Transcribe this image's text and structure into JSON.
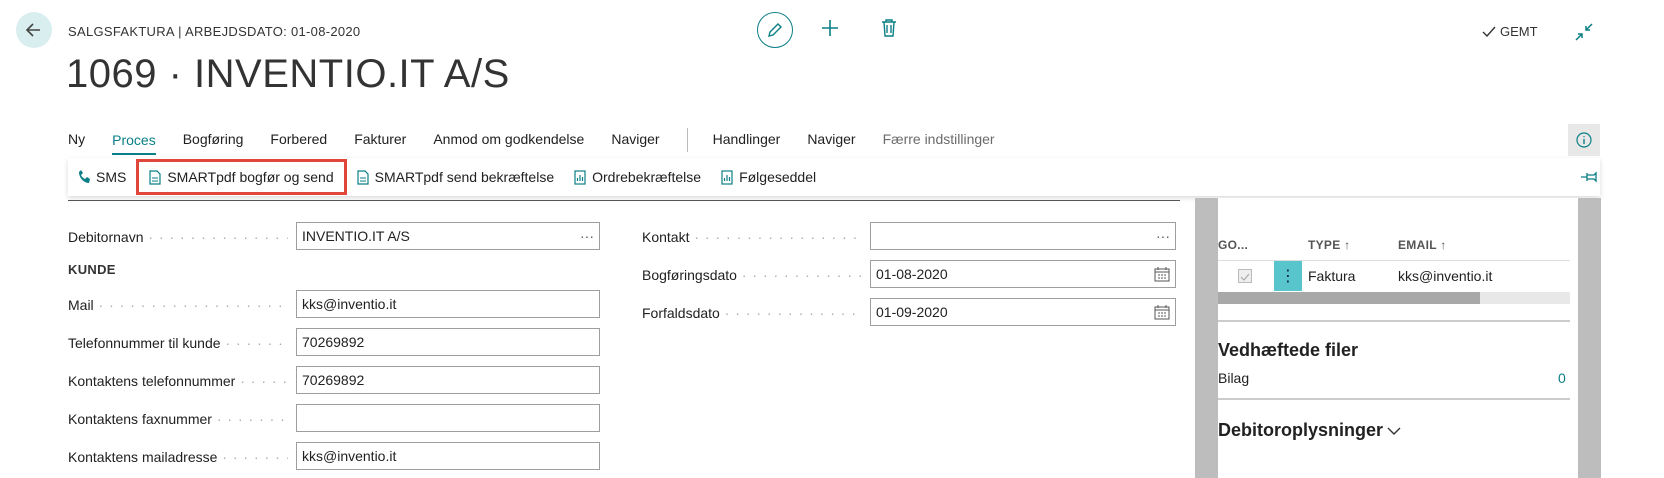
{
  "header": {
    "caption": "SALGSFAKTURA | ARBEJDSDATO: 01-08-2020",
    "title": "1069 · INVENTIO.IT A/S",
    "status": "GEMT"
  },
  "menu": {
    "items": [
      "Ny",
      "Proces",
      "Bogføring",
      "Forbered",
      "Fakturer",
      "Anmod om godkendelse",
      "Naviger"
    ],
    "items2": [
      "Handlinger",
      "Naviger"
    ],
    "fewer": "Færre indstillinger",
    "active": "Proces"
  },
  "actions": {
    "sms": "SMS",
    "post_send": "SMARTpdf bogfør og send",
    "send_confirm": "SMARTpdf send bekræftelse",
    "order_confirm": "Ordrebekræftelse",
    "packing_slip": "Følgeseddel"
  },
  "form": {
    "customer_name_label": "Debitornavn",
    "customer_name": "INVENTIO.IT A/S",
    "section_customer": "KUNDE",
    "mail_label": "Mail",
    "mail": "kks@inventio.it",
    "phone_label": "Telefonnummer til kunde",
    "phone": "70269892",
    "contact_phone_label": "Kontaktens telefonnummer",
    "contact_phone": "70269892",
    "contact_fax_label": "Kontaktens faxnummer",
    "contact_fax": "",
    "contact_email_label": "Kontaktens mailadresse",
    "contact_email": "kks@inventio.it",
    "contact_label": "Kontakt",
    "contact": "",
    "posting_date_label": "Bogføringsdato",
    "posting_date": "01-08-2020",
    "due_date_label": "Forfaldsdato",
    "due_date": "01-09-2020",
    "more": "···"
  },
  "factbox": {
    "grid_headers": [
      "GO...",
      "TYPE ↑",
      "EMAIL ↑"
    ],
    "grid_row": {
      "type": "Faktura",
      "email": "kks@inventio.it"
    },
    "attachments_title": "Vedhæftede filer",
    "attachments_label": "Bilag",
    "attachments_count": "0",
    "customer_info_title": "Debitoroplysninger"
  },
  "colors": {
    "accent": "#0a7f86",
    "highlight": "#e0463a"
  }
}
